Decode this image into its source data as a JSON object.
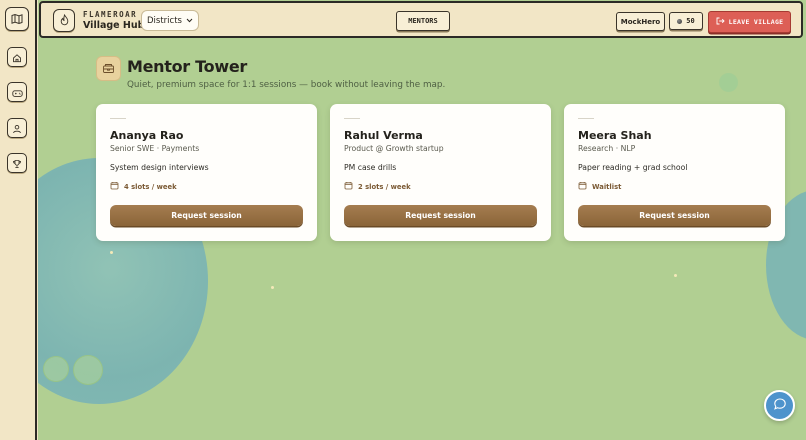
{
  "sidebar": {
    "items": [
      {
        "icon": "map-icon",
        "label": "Map"
      },
      {
        "icon": "home-icon",
        "label": "Home"
      },
      {
        "icon": "gamepad-icon",
        "label": "Games"
      },
      {
        "icon": "user-icon",
        "label": "Profile"
      },
      {
        "icon": "trophy-icon",
        "label": "Leaderboard"
      }
    ]
  },
  "topbar": {
    "brand_small": "FLAMEROAR",
    "brand_title": "Village Hub",
    "districts_label": "Districts",
    "mentors_label": "MENTORS",
    "user_label": "MockHero",
    "coins": "50",
    "leave_label": "LEAVE VILLAGE"
  },
  "page": {
    "title": "Mentor Tower",
    "subtitle": "Quiet, premium space for 1:1 sessions — book without leaving the map."
  },
  "mentors": [
    {
      "name": "Ananya Rao",
      "role": "Senior SWE · Payments",
      "topic": "System design interviews",
      "availability": "4 slots / week",
      "button": "Request session"
    },
    {
      "name": "Rahul Verma",
      "role": "Product @ Growth startup",
      "topic": "PM case drills",
      "availability": "2 slots / week",
      "button": "Request session"
    },
    {
      "name": "Meera Shah",
      "role": "Research · NLP",
      "topic": "Paper reading + grad school",
      "availability": "Waitlist",
      "button": "Request session"
    }
  ],
  "colors": {
    "map_green": "#b1cf92",
    "accent_brown": "#8a6438",
    "leave_red": "#dd5f56",
    "chat_blue": "#4e93cc"
  }
}
